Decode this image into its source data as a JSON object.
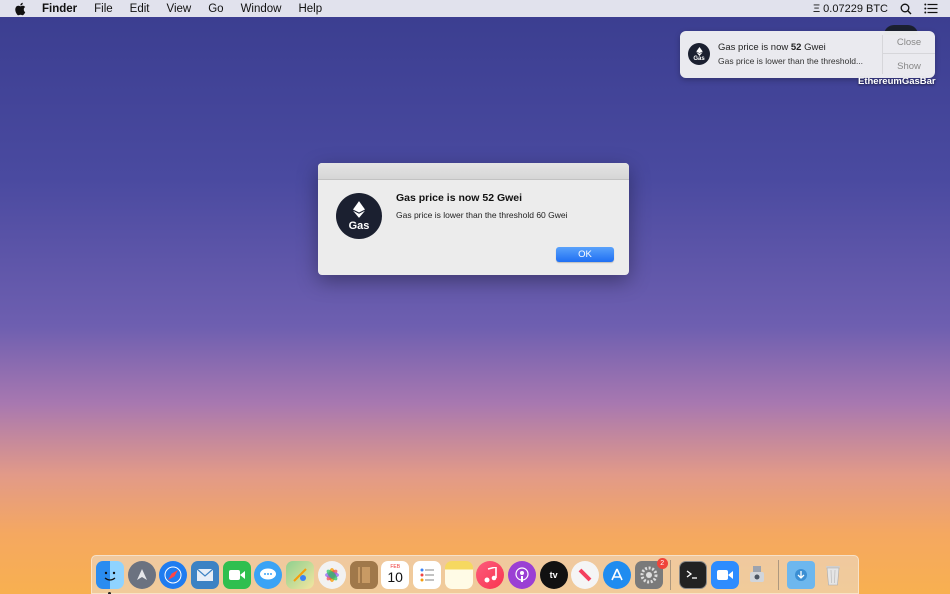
{
  "menubar": {
    "items": [
      {
        "label": "Finder",
        "bold": true
      },
      {
        "label": "File"
      },
      {
        "label": "Edit"
      },
      {
        "label": "View"
      },
      {
        "label": "Go"
      },
      {
        "label": "Window"
      },
      {
        "label": "Help"
      }
    ],
    "btc_status": "Ξ 0.07229 BTC"
  },
  "notification": {
    "title_prefix": "Gas price is now ",
    "title_value": "52",
    "title_suffix": " Gwei",
    "body": "Gas price is lower than the threshold...",
    "close_label": "Close",
    "show_label": "Show",
    "icon_text": "Gas"
  },
  "desktop": {
    "app_label": "EthereumGasBar"
  },
  "dialog": {
    "title": "Gas price is now 52 Gwei",
    "message": "Gas price is lower than the threshold 60 Gwei",
    "ok_label": "OK",
    "icon_text": "Gas"
  },
  "dock": {
    "apps": [
      {
        "name": "finder",
        "color": "#2a8cf0"
      },
      {
        "name": "launchpad",
        "color": "#6b7280"
      },
      {
        "name": "safari",
        "color": "#1f7cf0"
      },
      {
        "name": "mail",
        "color": "#3b82c4"
      },
      {
        "name": "facetime",
        "color": "#2fbf4f"
      },
      {
        "name": "messages",
        "color": "#3aa3f5"
      },
      {
        "name": "maps",
        "color": "#6cc070"
      },
      {
        "name": "photos",
        "color": "#f2f2f2"
      },
      {
        "name": "notes-brown",
        "color": "#a0784a"
      },
      {
        "name": "calendar",
        "color": "#ffffff"
      },
      {
        "name": "reminders",
        "color": "#ffffff"
      },
      {
        "name": "notes",
        "color": "#f6d860"
      },
      {
        "name": "music",
        "color": "#fa3b5b"
      },
      {
        "name": "podcasts",
        "color": "#9b3fd4"
      },
      {
        "name": "tv",
        "color": "#111111"
      },
      {
        "name": "news",
        "color": "#f5f5f5"
      },
      {
        "name": "app-store",
        "color": "#1f8cf0"
      },
      {
        "name": "system-preferences",
        "color": "#7a7a7a"
      },
      {
        "name": "terminal",
        "color": "#222222"
      },
      {
        "name": "zoom",
        "color": "#2d8cff"
      },
      {
        "name": "utility",
        "color": "#dddddd"
      },
      {
        "name": "downloads-folder",
        "color": "#6db7ee"
      },
      {
        "name": "trash",
        "color": "#d8d8d8"
      }
    ],
    "calendar_day": "10",
    "calendar_month": "FEB",
    "sysprefs_badge": "2"
  }
}
